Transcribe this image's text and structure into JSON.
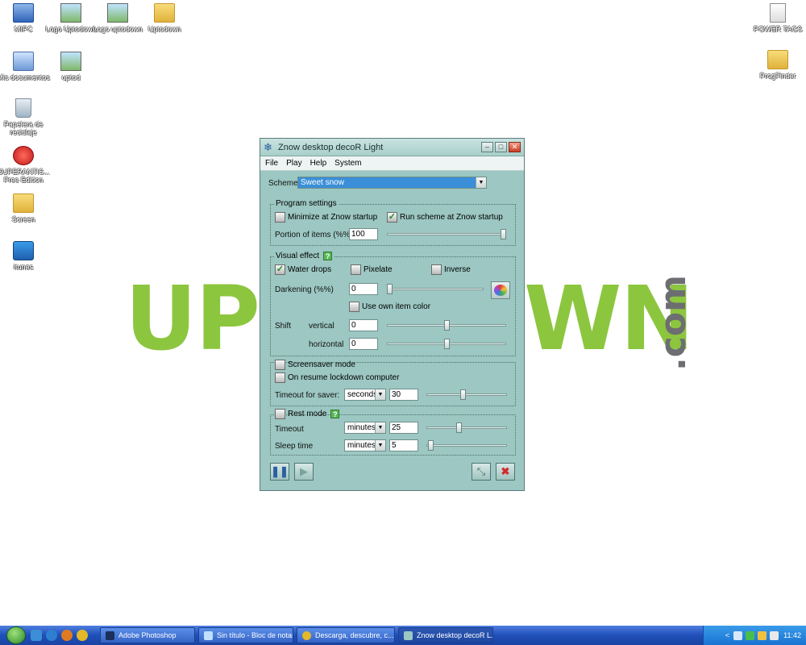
{
  "desktop": {
    "brand_left": "UP",
    "brand_right": "WN",
    "brand_dotcom": ".com",
    "icons": [
      {
        "label": "MIPC",
        "icon": "computer-icon"
      },
      {
        "label": "Logo Uptodown",
        "icon": "image-file-icon"
      },
      {
        "label": "Logo uptodown",
        "icon": "image-file-icon"
      },
      {
        "label": "Uptodown",
        "icon": "folder-icon"
      },
      {
        "label": "POWER TAGS",
        "icon": "file-icon"
      },
      {
        "label": "Mis documentos",
        "icon": "my-documents-icon"
      },
      {
        "label": "uptod",
        "icon": "image-file-icon"
      },
      {
        "label": "ProgFinder",
        "icon": "folder-icon"
      },
      {
        "label": "Papelera de reciclaje",
        "icon": "recycle-bin-icon"
      },
      {
        "label": "SUPERANTIS... Free Edition",
        "icon": "superantispyware-icon"
      },
      {
        "label": "Screen",
        "icon": "folder-icon"
      },
      {
        "label": "itunes",
        "icon": "itunes-icon"
      }
    ]
  },
  "window": {
    "title": "Znow desktop decoR Light",
    "menu": [
      "File",
      "Play",
      "Help",
      "System"
    ],
    "scheme": {
      "label": "Scheme",
      "value": "Sweet snow"
    },
    "program_settings": {
      "title": "Program settings",
      "minimize_label": "Minimize at Znow startup",
      "minimize_checked": false,
      "run_scheme_label": "Run scheme at Znow startup",
      "run_scheme_checked": true,
      "portion_label": "Portion of items (%%)",
      "portion_value": "100",
      "portion_slider": 1.0
    },
    "visual_effect": {
      "title": "Visual effect",
      "help": "?",
      "water_drops_label": "Water drops",
      "water_drops_checked": true,
      "pixelate_label": "Pixelate",
      "pixelate_checked": false,
      "inverse_label": "Inverse",
      "inverse_checked": false,
      "darkening_label": "Darkening (%%)",
      "darkening_value": "0",
      "darkening_slider": 0.0,
      "own_color_label": "Use own item color",
      "own_color_checked": false,
      "shift_label": "Shift",
      "vertical_label": "vertical",
      "vertical_value": "0",
      "vertical_slider": 0.5,
      "horizontal_label": "horizontal",
      "horizontal_value": "0",
      "horizontal_slider": 0.5
    },
    "screensaver": {
      "screensaver_label": "Screensaver mode",
      "screensaver_checked": false,
      "lockdown_label": "On resume lockdown computer",
      "lockdown_checked": false,
      "timeout_label": "Timeout for saver:",
      "timeout_unit": "seconds",
      "timeout_value": "30",
      "timeout_slider": 0.45
    },
    "rest_mode": {
      "title": "Rest mode",
      "help": "?",
      "checked": false,
      "timeout_label": "Timeout",
      "timeout_unit": "minutes",
      "timeout_value": "25",
      "timeout_slider": 0.4,
      "sleep_label": "Sleep time",
      "sleep_unit": "minutes",
      "sleep_value": "5",
      "sleep_slider": 0.05
    },
    "bottom": {
      "pause_icon": "pause-icon",
      "play_icon": "play-icon",
      "resize_icon": "resize-icon",
      "close_icon": "close-icon"
    }
  },
  "taskbar": {
    "items": [
      {
        "label": "Adobe Photoshop",
        "active": false
      },
      {
        "label": "Sin título - Bloc de notas",
        "active": false
      },
      {
        "label": "Descarga, descubre, c...",
        "active": false
      },
      {
        "label": "Znow desktop decoR L...",
        "active": true
      }
    ],
    "clock": "11:42"
  }
}
